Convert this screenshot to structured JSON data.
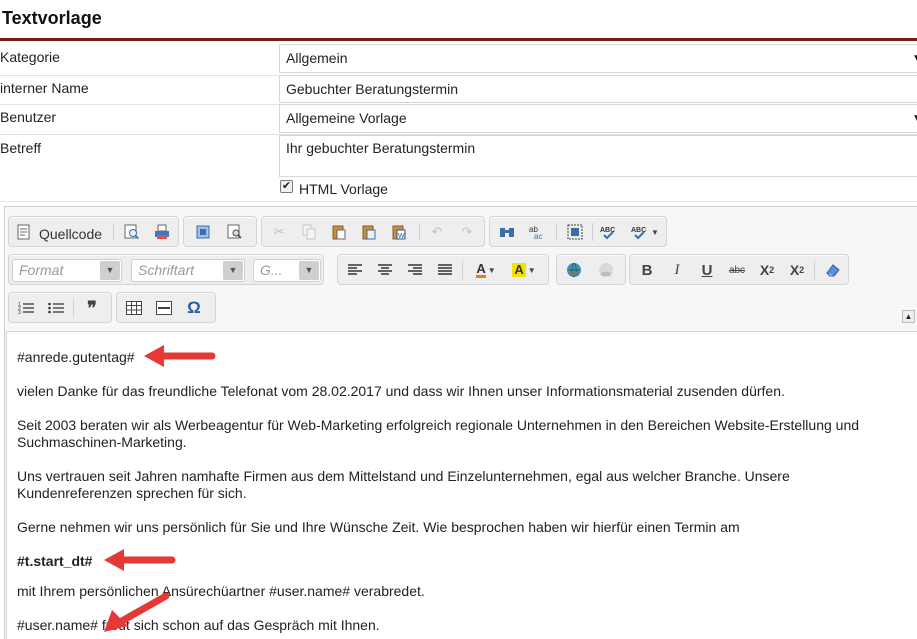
{
  "header": {
    "title": "Textvorlage"
  },
  "form": {
    "kategorie_label": "Kategorie",
    "kategorie_value": "Allgemein",
    "name_label": "interner Name",
    "name_value": "Gebuchter Beratungstermin",
    "benutzer_label": "Benutzer",
    "benutzer_value": "Allgemeine Vorlage",
    "betreff_label": "Betreff",
    "betreff_value": "Ihr gebuchter Beratungstermin",
    "html_checked": true,
    "html_label": "HTML Vorlage"
  },
  "toolbar": {
    "quellcode_label": "Quellcode",
    "format_placeholder": "Format",
    "schriftart_placeholder": "Schriftart",
    "groesse_placeholder": "G..."
  },
  "content": {
    "p1": "#anrede.gutentag#",
    "p2": "vielen Danke für das freundliche Telefonat vom 28.02.2017 und dass wir Ihnen unser Informationsmaterial zusenden dürfen.",
    "p3": "Seit 2003 beraten wir als Werbeagentur für Web-Marketing erfolgreich regionale Unternehmen in den Bereichen Website-Erstellung und Suchmaschinen-Marketing.",
    "p4": "Uns vertrauen seit Jahren namhafte Firmen aus dem Mittelstand und Einzelunternehmen, egal aus welcher Branche. Unsere Kundenreferenzen sprechen für sich.",
    "p5": "Gerne nehmen wir uns persönlich für Sie und Ihre Wünsche Zeit. Wie besprochen haben wir hierfür einen Termin am",
    "p6": "#t.start_dt#",
    "p7": "mit Ihrem persönlichen Ansürechüartner #user.name# verabredet.",
    "p8": "#user.name# freut sich schon auf das Gespräch mit Ihnen."
  },
  "colors": {
    "accent_rule": "#7a1a1a",
    "annotation_arrow": "#e53935"
  },
  "icons": [
    "source-icon",
    "preview-icon",
    "print-icon",
    "template-icon",
    "find-replace-icon",
    "cut-icon",
    "copy-icon",
    "paste-icon",
    "paste-text-icon",
    "paste-word-icon",
    "undo-icon",
    "redo-icon",
    "find-icon",
    "replace-icon",
    "select-all-icon",
    "spellcheck-icon",
    "spellcheck-dropdown-icon",
    "align-left-icon",
    "align-center-icon",
    "align-right-icon",
    "justify-icon",
    "text-color-icon",
    "bg-color-icon",
    "link-icon",
    "unlink-icon",
    "bold-icon",
    "italic-icon",
    "underline-icon",
    "strikethrough-icon",
    "subscript-icon",
    "superscript-icon",
    "remove-format-icon",
    "numbered-list-icon",
    "bullet-list-icon",
    "blockquote-icon",
    "table-icon",
    "horizontal-rule-icon",
    "special-char-icon"
  ]
}
